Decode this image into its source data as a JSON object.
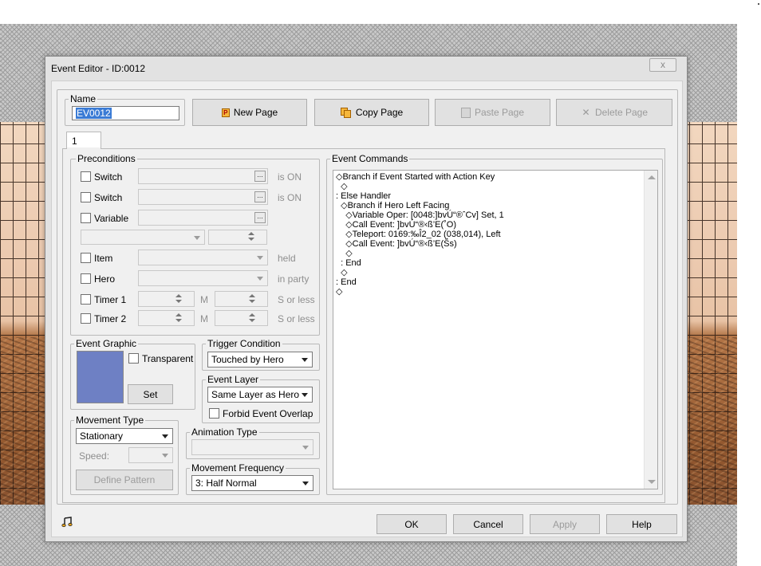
{
  "window": {
    "title": "Event Editor - ID:0012",
    "close_label": "x"
  },
  "name_group": {
    "label": "Name",
    "value": "EV0012"
  },
  "page_buttons": {
    "new_page": "New Page",
    "copy_page": "Copy Page",
    "paste_page": "Paste Page",
    "delete_page": "Delete Page"
  },
  "tabs": [
    {
      "label": "1"
    }
  ],
  "preconditions": {
    "label": "Preconditions",
    "switch1": {
      "label": "Switch",
      "suffix": "is ON"
    },
    "switch2": {
      "label": "Switch",
      "suffix": "is ON"
    },
    "variable": {
      "label": "Variable"
    },
    "item": {
      "label": "Item",
      "suffix": "held"
    },
    "hero": {
      "label": "Hero",
      "suffix": "in party"
    },
    "timer1": {
      "label": "Timer 1",
      "m": "M",
      "suffix": "S or less"
    },
    "timer2": {
      "label": "Timer 2",
      "m": "M",
      "suffix": "S or less"
    },
    "dots": "..."
  },
  "event_graphic": {
    "label": "Event Graphic",
    "transparent_label": "Transparent",
    "set_label": "Set",
    "preview_color": "#6e80c4"
  },
  "trigger_condition": {
    "label": "Trigger Condition",
    "value": "Touched by Hero"
  },
  "event_layer": {
    "label": "Event Layer",
    "value": "Same Layer as Hero",
    "forbid_label": "Forbid Event Overlap"
  },
  "movement_type": {
    "label": "Movement Type",
    "value": "Stationary",
    "speed_label": "Speed:",
    "define_pattern_label": "Define Pattern"
  },
  "animation_type": {
    "label": "Animation Type",
    "value": ""
  },
  "movement_frequency": {
    "label": "Movement Frequency",
    "value": "3: Half Normal"
  },
  "event_commands": {
    "label": "Event Commands",
    "lines": [
      "◇Branch if Event Started with Action Key",
      "  ◇",
      ": Else Handler",
      "  ◇Branch if Hero Left Facing",
      "    ◇Variable Oper: [0048:]bvÚ“®ˆCv] Set, 1",
      "    ◇Call Event: ]bvÚ“®‹ß’E(˚O)",
      "    ◇Teleport: 0169:‰Î2_02 (038,014), Left",
      "    ◇Call Event: ]bvÚ“®‹ß’E(Ś̈s)",
      "    ◇",
      "  : End",
      "  ◇",
      ": End",
      "◇"
    ]
  },
  "footer": {
    "ok": "OK",
    "cancel": "Cancel",
    "apply": "Apply",
    "help": "Help"
  },
  "icons": {
    "music": "music-note-icon"
  }
}
